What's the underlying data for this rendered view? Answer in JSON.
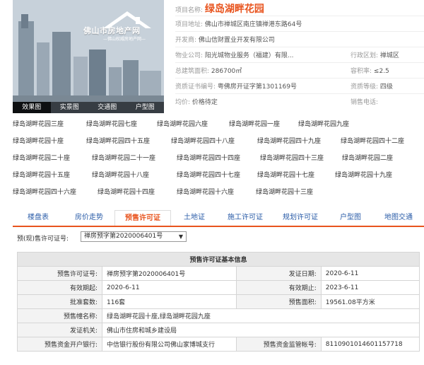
{
  "hero": {
    "logo_text": "佛山市房地产网",
    "logo_sub": "—佛山权威房地产网—",
    "tabs": [
      "效果图",
      "实景图",
      "交通图",
      "户型图"
    ]
  },
  "info": {
    "project_name_label": "项目名称:",
    "project_name": "绿岛湖畔花园",
    "address_label": "项目地址:",
    "address": "佛山市禅城区南庄镇禅港东路64号",
    "developer_label": "开发商:",
    "developer": "佛山信财置业开发有限公司",
    "property_label": "物业公司:",
    "property": "阳光城物业服务（福建）有限...",
    "district_label": "行政区划:",
    "district": "禅城区",
    "area_label": "总建筑面积:",
    "area": "286700㎡",
    "ratio_label": "容积率:",
    "ratio": "≤2.5",
    "cert_label": "资质证书编号:",
    "cert": "粤佛房开证字第1301169号",
    "grade_label": "资质等级:",
    "grade": "四级",
    "price_label": "均价:",
    "price": "价格待定",
    "phone_label": "销售电话:",
    "phone": ""
  },
  "buildings": [
    "绿岛湖畔花园三座",
    "绿岛湖畔花园七座",
    "绿岛湖畔花园六座",
    "绿岛湖畔花园一座",
    "绿岛湖畔花园九座",
    "绿岛湖畔花园十座",
    "绿岛湖畔花园四十五座",
    "绿岛湖畔花园四十八座",
    "绿岛湖畔花园四十九座",
    "绿岛湖畔花园四十二座",
    "绿岛湖畔花园二十座",
    "绿岛湖畔花园二十一座",
    "绿岛湖畔花园四十四座",
    "绿岛湖畔花园四十三座",
    "绿岛湖畔花园二座",
    "绿岛湖畔花园十五座",
    "绿岛湖畔花园十八座",
    "绿岛湖畔花园四十七座",
    "绿岛湖畔花园十七座",
    "绿岛湖畔花园十九座",
    "绿岛湖畔花园四十六座",
    "绿岛湖畔花园十四座",
    "绿岛湖畔花园十六座",
    "绿岛湖畔花园十三座"
  ],
  "nav": [
    "楼盘表",
    "房价走势",
    "预售许可证",
    "土地证",
    "施工许可证",
    "规划许可证",
    "户型图",
    "地图交通"
  ],
  "select": {
    "label": "预(现)售许可证号:",
    "value": "禅房预字第2020006401号"
  },
  "table": {
    "title": "预售许可证基本信息",
    "rows": [
      {
        "k1": "预售许可证号:",
        "v1": "禅房预字第2020006401号",
        "k2": "发证日期:",
        "v2": "2020-6-11"
      },
      {
        "k1": "有效期起:",
        "v1": "2020-6-11",
        "k2": "有效期止:",
        "v2": "2023-6-11"
      },
      {
        "k1": "批准套数:",
        "v1": "116套",
        "k2": "预售面积:",
        "v2": "19561.08平方米"
      }
    ],
    "wide_rows": [
      {
        "k": "预售幢名称:",
        "v": "绿岛湖畔花园十座,绿岛湖畔花园九座"
      },
      {
        "k": "发证机关:",
        "v": "佛山市住房和城乡建设局"
      }
    ],
    "bank_label": "预售资金开户银行:",
    "bank": "中信银行股份有限公司佛山家博城支行",
    "account_label": "预售资金监管帐号:",
    "account": "8110901014601157718"
  },
  "colors": {
    "accent": "#e8541e",
    "link": "#2a5ca8"
  }
}
